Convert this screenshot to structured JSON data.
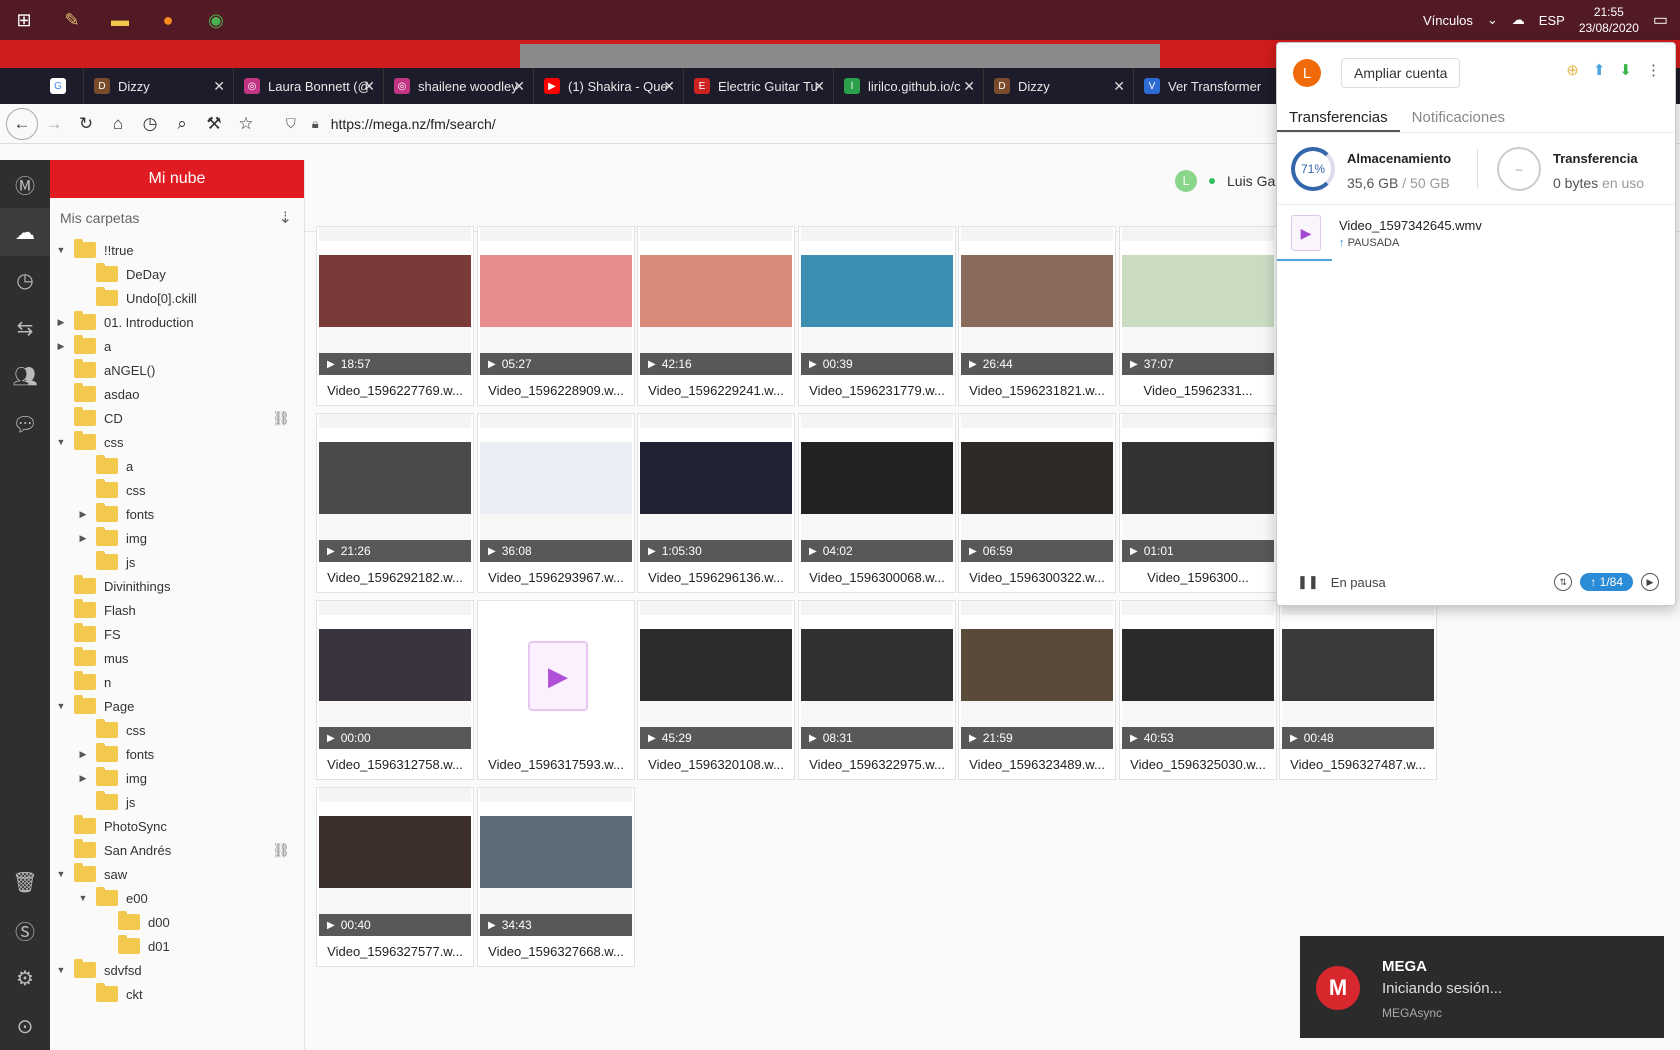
{
  "taskbar": {
    "vinculos": "Vínculos",
    "lang": "ESP",
    "time": "21:55",
    "date": "23/08/2020"
  },
  "browser": {
    "tabs": [
      {
        "title": "",
        "fav_color": "#ffffff",
        "fav_letter": "G"
      },
      {
        "title": "Dizzy",
        "fav_color": "#7a4b2a",
        "fav_letter": "D"
      },
      {
        "title": "Laura Bonnett (@",
        "fav_color": "#c13584",
        "fav_letter": "◎"
      },
      {
        "title": "shailene woodley",
        "fav_color": "#c13584",
        "fav_letter": "◎"
      },
      {
        "title": "(1) Shakira - Que",
        "fav_color": "#ff0000",
        "fav_letter": "▶"
      },
      {
        "title": "Electric Guitar Tur",
        "fav_color": "#cc2222",
        "fav_letter": "E"
      },
      {
        "title": "lirilco.github.io/c",
        "fav_color": "#2aa14a",
        "fav_letter": "l"
      },
      {
        "title": "Dizzy",
        "fav_color": "#7a4b2a",
        "fav_letter": "D"
      },
      {
        "title": "Ver Transformer",
        "fav_color": "#2d6bd6",
        "fav_letter": "V"
      }
    ],
    "url": "https://mega.nz/fm/search/"
  },
  "sidebar": {
    "title": "Mi nube",
    "section": "Mis carpetas",
    "tree": [
      {
        "label": "!!true",
        "level": 0,
        "arrow": "▼"
      },
      {
        "label": "DeDay",
        "level": 1,
        "arrow": ""
      },
      {
        "label": "Undo[0].ckill",
        "level": 1,
        "arrow": ""
      },
      {
        "label": "01. Introduction",
        "level": 0,
        "arrow": "▶"
      },
      {
        "label": "a",
        "level": 0,
        "arrow": "▶"
      },
      {
        "label": "aNGEL()",
        "level": 0,
        "arrow": ""
      },
      {
        "label": "asdao",
        "level": 0,
        "arrow": ""
      },
      {
        "label": "CD",
        "level": 0,
        "arrow": "",
        "link": true
      },
      {
        "label": "css",
        "level": 0,
        "arrow": "▼"
      },
      {
        "label": "a",
        "level": 1,
        "arrow": ""
      },
      {
        "label": "css",
        "level": 1,
        "arrow": ""
      },
      {
        "label": "fonts",
        "level": 1,
        "arrow": "▶"
      },
      {
        "label": "img",
        "level": 1,
        "arrow": "▶"
      },
      {
        "label": "js",
        "level": 1,
        "arrow": ""
      },
      {
        "label": "Divinithings",
        "level": 0,
        "arrow": ""
      },
      {
        "label": "Flash",
        "level": 0,
        "arrow": ""
      },
      {
        "label": "FS",
        "level": 0,
        "arrow": ""
      },
      {
        "label": "mus",
        "level": 0,
        "arrow": ""
      },
      {
        "label": "n",
        "level": 0,
        "arrow": ""
      },
      {
        "label": "Page",
        "level": 0,
        "arrow": "▼"
      },
      {
        "label": "css",
        "level": 1,
        "arrow": ""
      },
      {
        "label": "fonts",
        "level": 1,
        "arrow": "▶"
      },
      {
        "label": "img",
        "level": 1,
        "arrow": "▶"
      },
      {
        "label": "js",
        "level": 1,
        "arrow": ""
      },
      {
        "label": "PhotoSync",
        "level": 0,
        "arrow": ""
      },
      {
        "label": "San Andrés",
        "level": 0,
        "arrow": "",
        "link": true
      },
      {
        "label": "saw",
        "level": 0,
        "arrow": "▼"
      },
      {
        "label": "e00",
        "level": 1,
        "arrow": "▼"
      },
      {
        "label": "d00",
        "level": 2,
        "arrow": ""
      },
      {
        "label": "d01",
        "level": 2,
        "arrow": ""
      },
      {
        "label": "sdvfsd",
        "level": 0,
        "arrow": "▼"
      },
      {
        "label": "ckt",
        "level": 1,
        "arrow": ""
      }
    ]
  },
  "header": {
    "user_initial": "L",
    "user_name": "Luis Ga"
  },
  "files": [
    {
      "name": "Video_1596227769.w...",
      "duration": "18:57",
      "color": "#7a3a3a"
    },
    {
      "name": "Video_1596228909.w...",
      "duration": "05:27",
      "color": "#e88d8d"
    },
    {
      "name": "Video_1596229241.w...",
      "duration": "42:16",
      "color": "#d98a7a"
    },
    {
      "name": "Video_1596231779.w...",
      "duration": "00:39",
      "color": "#3c8fb0"
    },
    {
      "name": "Video_1596231821.w...",
      "duration": "26:44",
      "color": "#8a6a5a"
    },
    {
      "name": "Video_15962331...",
      "duration": "37:07",
      "color": "#c9dcc2"
    },
    {
      "name": "Video_1596292182.w...",
      "duration": "21:26",
      "color": "#4a4a4a"
    },
    {
      "name": "Video_1596293967.w...",
      "duration": "36:08",
      "color": "#e9eef5"
    },
    {
      "name": "Video_1596296136.w...",
      "duration": "1:05:30",
      "color": "#1f2333"
    },
    {
      "name": "Video_1596300068.w...",
      "duration": "04:02",
      "color": "#222222"
    },
    {
      "name": "Video_1596300322.w...",
      "duration": "06:59",
      "color": "#2f2a28"
    },
    {
      "name": "Video_1596300...",
      "duration": "01:01",
      "color": "#333333"
    },
    {
      "name": "Video_1596312758.w...",
      "duration": "00:00",
      "color": "#3a3440"
    },
    {
      "name": "Video_1596317593.w...",
      "duration": "",
      "color": "#ffffff",
      "placeholder": true
    },
    {
      "name": "Video_1596320108.w...",
      "duration": "45:29",
      "color": "#2c2c2c"
    },
    {
      "name": "Video_1596322975.w...",
      "duration": "08:31",
      "color": "#303030"
    },
    {
      "name": "Video_1596323489.w...",
      "duration": "21:59",
      "color": "#5a4a3a"
    },
    {
      "name": "Video_1596325030.w...",
      "duration": "40:53",
      "color": "#2a2a2a"
    },
    {
      "name": "Video_1596327487.w...",
      "duration": "00:48",
      "color": "#3a3a3a"
    },
    {
      "name": "Video_1596327577.w...",
      "duration": "00:40",
      "color": "#3d2f2a"
    },
    {
      "name": "Video_1596327668.w...",
      "duration": "34:43",
      "color": "#5d6a78"
    }
  ],
  "popup": {
    "avatar": "L",
    "upgrade": "Ampliar cuenta",
    "tab_transfers": "Transferencias",
    "tab_notifications": "Notificaciones",
    "storage_pct": "71%",
    "storage_title": "Almacenamiento",
    "storage_used": "35,6 GB",
    "storage_total": "/ 50 GB",
    "transfer_title": "Transferencia",
    "transfer_val": "0 bytes",
    "transfer_suffix": "en uso",
    "item_name": "Video_1597342645.wmv",
    "item_status": "PAUSADA",
    "paused_label": "En pausa",
    "counter": "1/84"
  },
  "toast": {
    "title": "MEGA",
    "message": "Iniciando sesión...",
    "app": "MEGAsync"
  }
}
